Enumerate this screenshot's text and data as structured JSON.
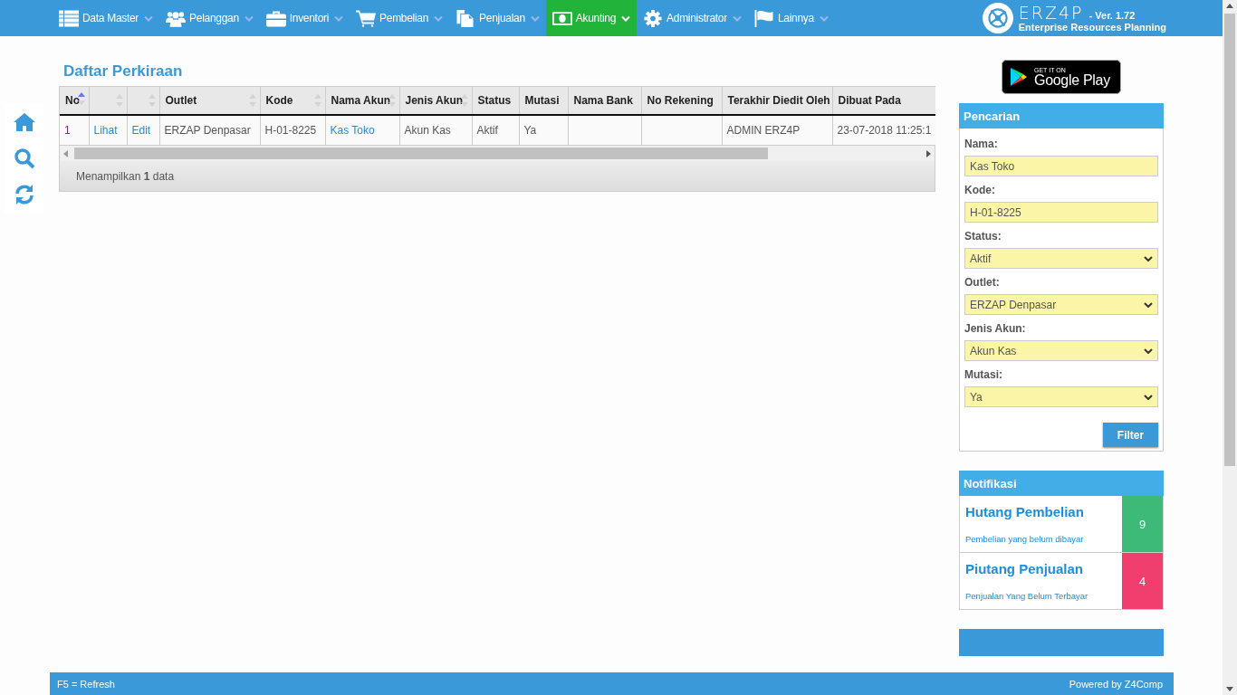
{
  "nav": {
    "items": [
      {
        "label": "Data Master",
        "selected": false
      },
      {
        "label": "Pelanggan",
        "selected": false
      },
      {
        "label": "Inventori",
        "selected": false
      },
      {
        "label": "Pembelian",
        "selected": false
      },
      {
        "label": "Penjualan",
        "selected": false
      },
      {
        "label": "Akunting",
        "selected": true
      },
      {
        "label": "Administrator",
        "selected": false
      },
      {
        "label": "Lainnya",
        "selected": false
      }
    ],
    "brand": {
      "name": "ERZ4P",
      "version": "- Ver. 1.72",
      "tagline": "Enterprise Resources Planning"
    }
  },
  "page_title": "Daftar Perkiraan",
  "table": {
    "columns": [
      {
        "label": "No",
        "sorted": true
      },
      {
        "sorted": false
      },
      {
        "sorted": false
      },
      {
        "label": "Outlet",
        "sorted": false
      },
      {
        "label": "Kode",
        "sorted": false
      },
      {
        "label": "Nama Akun",
        "sorted": false
      },
      {
        "label": "Jenis Akun",
        "sorted": false
      },
      {
        "label": "Status"
      },
      {
        "label": "Mutasi"
      },
      {
        "label": "Nama Bank"
      },
      {
        "label": "No Rekening"
      },
      {
        "label": "Terakhir Diedit Oleh"
      },
      {
        "label": "Dibuat Pada"
      }
    ],
    "rows": [
      [
        {
          "kind": "number",
          "text": "1"
        },
        {
          "kind": "link",
          "text": "Lihat"
        },
        {
          "kind": "link",
          "text": "Edit"
        },
        {
          "kind": "text",
          "text": "ERZAP Denpasar"
        },
        {
          "kind": "text",
          "text": "H-01-8225"
        },
        {
          "kind": "link",
          "text": "Kas Toko"
        },
        {
          "kind": "text",
          "text": "Akun Kas"
        },
        {
          "kind": "text",
          "text": "Aktif"
        },
        {
          "kind": "text",
          "text": "Ya"
        },
        {
          "kind": "empty"
        },
        {
          "kind": "empty"
        },
        {
          "kind": "text",
          "text": "ADMIN ERZ4P"
        },
        {
          "kind": "text",
          "text": "23-07-2018 11:25:1"
        }
      ]
    ],
    "footer": "Menampilkan **1** data"
  },
  "store_badge": {
    "small": "GET IT ON",
    "large": "Google Play"
  },
  "search_panel": {
    "title": "Pencarian",
    "fields": [
      {
        "kind": "input",
        "label": "Nama:",
        "value": "Kas Toko"
      },
      {
        "kind": "input",
        "label": "Kode:",
        "value": "H-01-8225"
      },
      {
        "kind": "select",
        "label": "Status:",
        "value": "Aktif"
      },
      {
        "kind": "select",
        "label": "Outlet:",
        "value": "ERZAP Denpasar"
      },
      {
        "kind": "select",
        "label": "Jenis Akun:",
        "value": "Akun Kas"
      },
      {
        "kind": "select",
        "label": "Mutasi:",
        "value": "Ya"
      }
    ],
    "button": "Filter"
  },
  "notifications": {
    "title": "Notifikasi",
    "items": [
      {
        "title": "Hutang Pembelian",
        "subtitle": "Pembelian yang belum dibayar",
        "count": "9",
        "color": "#3dba78"
      },
      {
        "title": "Piutang Penjualan",
        "subtitle": "Penjualan Yang Belum Terbayar",
        "count": "4",
        "color": "#f03f6e"
      }
    ]
  },
  "status_bar": {
    "left": "F5 = Refresh",
    "right": "Powered by Z4Comp"
  }
}
